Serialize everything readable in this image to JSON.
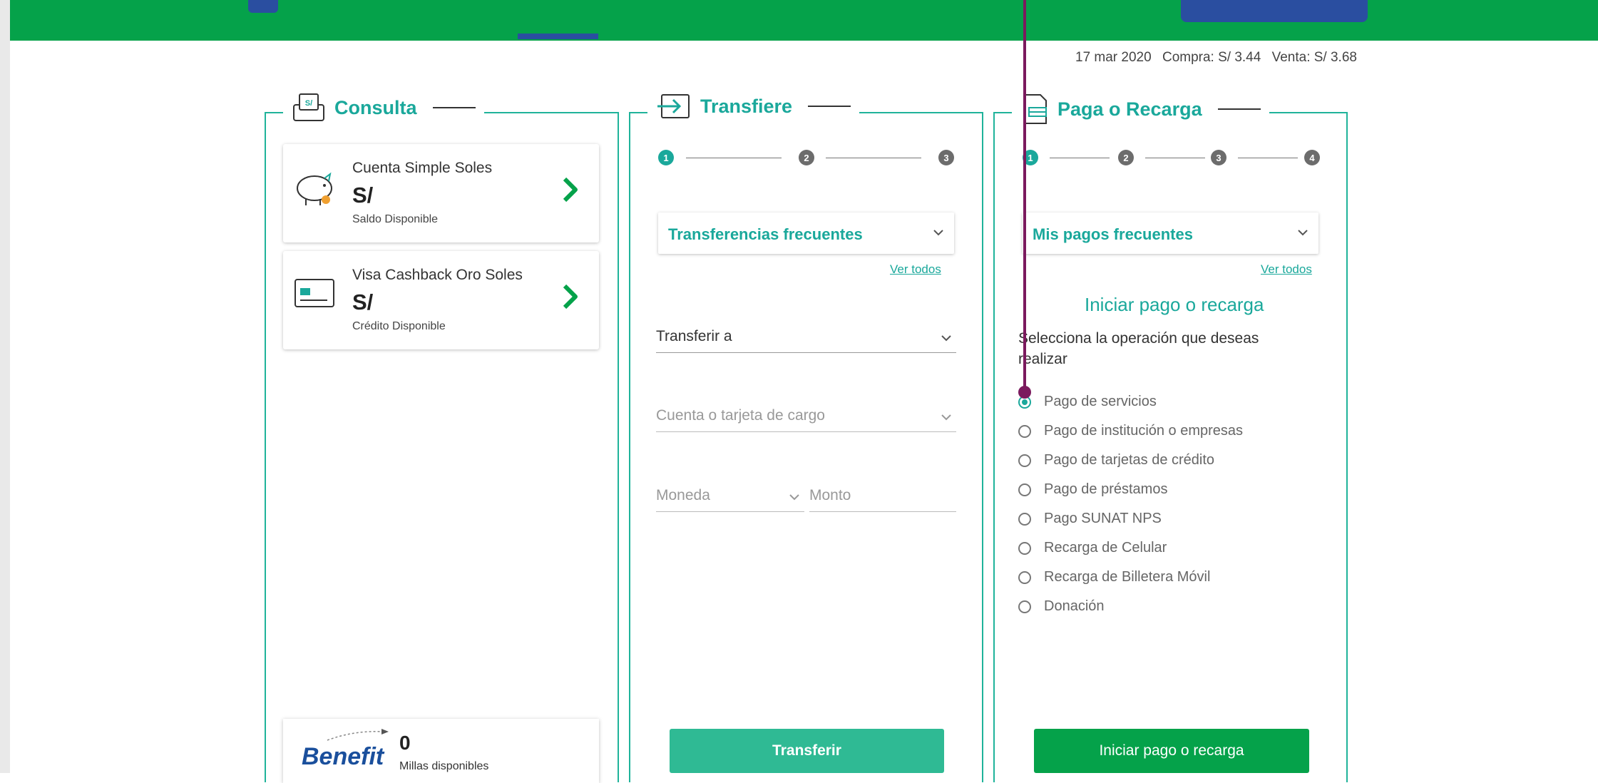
{
  "rates": {
    "date": "17 mar 2020",
    "compra": "Compra: S/ 3.44",
    "venta": "Venta: S/ 3.68"
  },
  "consulta": {
    "title": "Consulta",
    "accounts": [
      {
        "name": "Cuenta Simple Soles",
        "amount": "S/",
        "sub": "Saldo Disponible"
      },
      {
        "name": "Visa Cashback Oro Soles",
        "amount": "S/",
        "sub": "Crédito Disponible"
      }
    ],
    "benefit": {
      "logo": "Benefit",
      "miles": "0",
      "miles_label": "Millas disponibles"
    }
  },
  "transfiere": {
    "title": "Transfiere",
    "steps": [
      "1",
      "2",
      "3"
    ],
    "frequent_select": "Transferencias frecuentes",
    "ver_todos": "Ver todos",
    "transferir_a": "Transferir a",
    "cuenta_placeholder": "Cuenta o tarjeta de cargo",
    "moneda_placeholder": "Moneda",
    "monto_placeholder": "Monto",
    "button": "Transferir"
  },
  "paga": {
    "title": "Paga o Recarga",
    "steps": [
      "1",
      "2",
      "3",
      "4"
    ],
    "frequent_select": "Mis pagos frecuentes",
    "ver_todos": "Ver todos",
    "heading": "Iniciar pago o recarga",
    "instruction": "Selecciona la operación que deseas realizar",
    "options": [
      "Pago de servicios",
      "Pago de institución o empresas",
      "Pago de tarjetas de crédito",
      "Pago de préstamos",
      "Pago SUNAT NPS",
      "Recarga de Celular",
      "Recarga de Billetera Móvil",
      "Donación"
    ],
    "selected_option": "Pago de servicios",
    "button": "Iniciar pago o recarga"
  },
  "colors": {
    "brand_green": "#05a24a",
    "accent_teal": "#1aa89b",
    "nav_blue": "#2a4ea0",
    "annotation": "#7b1a5e"
  }
}
